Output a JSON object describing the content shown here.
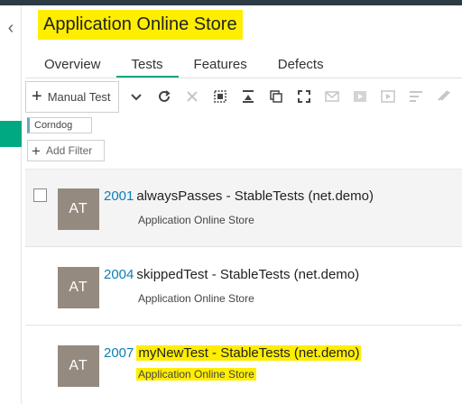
{
  "header": {
    "back_icon": "chevron-left-icon",
    "title": "Application Online Store"
  },
  "tabs": [
    {
      "label": "Overview",
      "active": false
    },
    {
      "label": "Tests",
      "active": true
    },
    {
      "label": "Features",
      "active": false
    },
    {
      "label": "Defects",
      "active": false
    }
  ],
  "toolbar": {
    "manual_test_label": "Manual Test",
    "icons": [
      "chevron-down-icon",
      "refresh-icon",
      "delete-icon",
      "select-all-icon",
      "collapse-icon",
      "copy-icon",
      "fullscreen-icon",
      "email-icon",
      "run-icon",
      "run-suite-icon",
      "filter-icon",
      "link-icon"
    ]
  },
  "filters": {
    "chip_label": "Corndog",
    "add_filter_label": "Add Filter"
  },
  "colors": {
    "accent": "#01a982",
    "highlight": "#ffee00",
    "avatar": "#948a80",
    "id_link": "#0a7fb5"
  },
  "tests": [
    {
      "avatar": "AT",
      "id": "2001",
      "name": "alwaysPasses - StableTests (net.demo)",
      "subtitle": "Application Online Store"
    },
    {
      "avatar": "AT",
      "id": "2004",
      "name": "skippedTest - StableTests (net.demo)",
      "subtitle": "Application Online Store"
    },
    {
      "avatar": "AT",
      "id": "2007",
      "name": "myNewTest - StableTests (net.demo)",
      "subtitle": "Application Online Store"
    }
  ]
}
